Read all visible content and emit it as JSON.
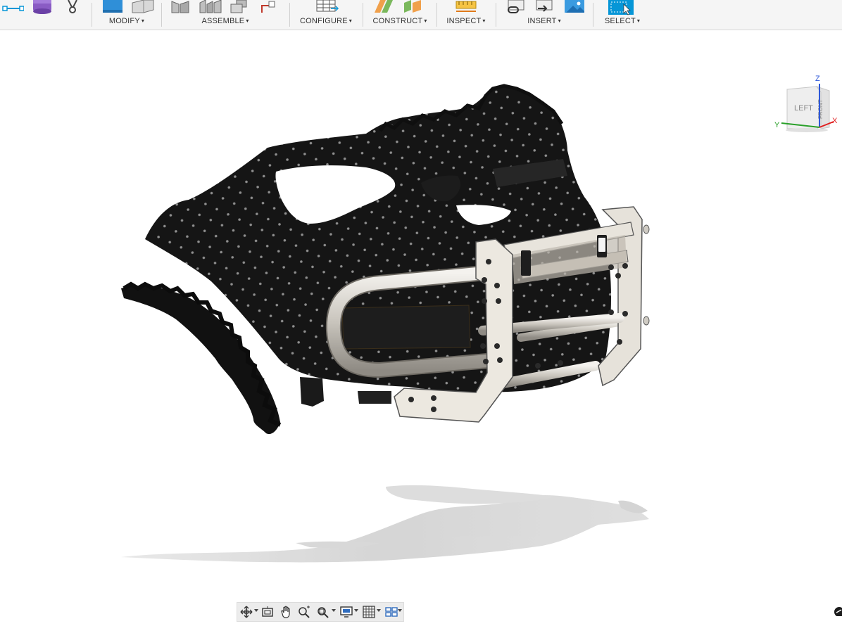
{
  "toolbar": {
    "groups": [
      {
        "label": "MODIFY"
      },
      {
        "label": "ASSEMBLE"
      },
      {
        "label": "CONFIGURE"
      },
      {
        "label": "CONSTRUCT"
      },
      {
        "label": "INSPECT"
      },
      {
        "label": "INSERT"
      },
      {
        "label": "SELECT"
      }
    ],
    "caret": "▾"
  },
  "viewcube": {
    "face_left": "LEFT",
    "face_front": "FRONT",
    "axis_z": "Z",
    "axis_y": "Y",
    "axis_x": "X"
  },
  "navbar": {
    "buttons": [
      "orbit-icon",
      "look-at-icon",
      "pan-icon",
      "zoom-icon",
      "fit-icon",
      "display-settings-icon",
      "grid-icon",
      "viewports-icon"
    ]
  },
  "colors": {
    "accent": "#0696d7",
    "toolbar_bg": "#f5f5f5",
    "model_dark": "#1a1a1a",
    "bracket": "#e8e4dc"
  }
}
